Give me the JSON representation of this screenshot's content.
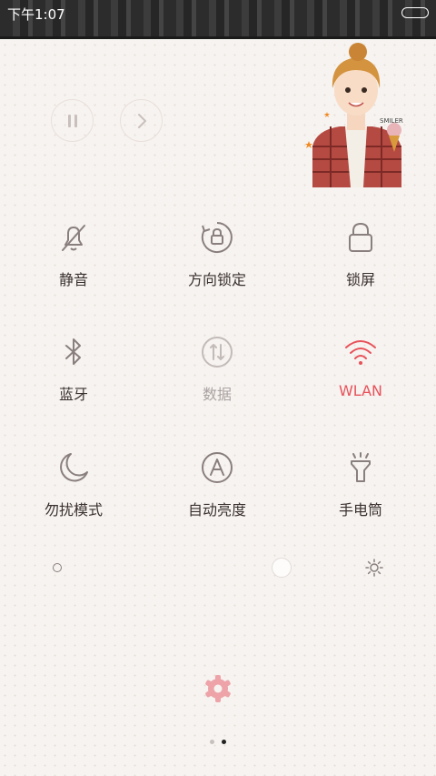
{
  "status_bar": {
    "time": "下午1:07"
  },
  "toggles": [
    {
      "id": "mute",
      "label": "静音",
      "icon": "bell-off-icon",
      "state": "off"
    },
    {
      "id": "orientation-lock",
      "label": "方向锁定",
      "icon": "rotation-lock-icon",
      "state": "off"
    },
    {
      "id": "lock-screen",
      "label": "锁屏",
      "icon": "lock-icon",
      "state": "off"
    },
    {
      "id": "bluetooth",
      "label": "蓝牙",
      "icon": "bluetooth-icon",
      "state": "off"
    },
    {
      "id": "mobile-data",
      "label": "数据",
      "icon": "data-transfer-icon",
      "state": "disabled"
    },
    {
      "id": "wlan",
      "label": "WLAN",
      "icon": "wifi-icon",
      "state": "on"
    },
    {
      "id": "do-not-disturb",
      "label": "勿扰模式",
      "icon": "moon-icon",
      "state": "off"
    },
    {
      "id": "auto-brightness",
      "label": "自动亮度",
      "icon": "auto-brightness-icon",
      "state": "off"
    },
    {
      "id": "flashlight",
      "label": "手电筒",
      "icon": "flashlight-icon",
      "state": "off"
    }
  ],
  "brightness": {
    "level": 0.7
  },
  "pager": {
    "total": 2,
    "current": 2
  },
  "colors": {
    "accent": "#e8525a",
    "icon": "#8a7f7f",
    "label": "#3a3030",
    "settings_gear": "#eda3a8"
  }
}
